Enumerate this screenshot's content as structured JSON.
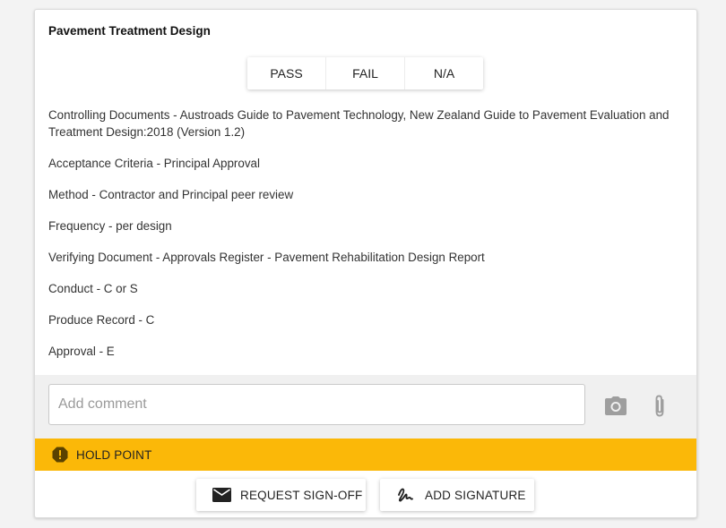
{
  "card": {
    "title": "Pavement Treatment Design",
    "options": [
      {
        "label": "PASS"
      },
      {
        "label": "FAIL"
      },
      {
        "label": "N/A"
      }
    ],
    "details": [
      {
        "text": "Controlling Documents - Austroads Guide to Pavement Technology, New Zealand Guide to Pavement Evaluation and Treatment Design:2018 (Version 1.2)"
      },
      {
        "text": "Acceptance Criteria - Principal Approval"
      },
      {
        "text": "Method - Contractor and Principal peer review"
      },
      {
        "text": "Frequency - per design"
      },
      {
        "text": "Verifying Document - Approvals Register - Pavement Rehabilitation Design Report"
      },
      {
        "text": "Conduct - C or S"
      },
      {
        "text": "Produce Record - C"
      },
      {
        "text": "Approval - E"
      }
    ],
    "comment": {
      "placeholder": "Add comment",
      "value": ""
    },
    "icons": {
      "camera": "camera-icon",
      "attach": "paperclip-icon",
      "hold": "alert-icon",
      "mail": "mail-icon",
      "signature": "signature-icon"
    },
    "hold_point": {
      "label": "HOLD POINT",
      "color": "#fbb808"
    },
    "actions": {
      "request_signoff": "REQUEST SIGN-OFF",
      "add_signature": "ADD SIGNATURE"
    }
  }
}
